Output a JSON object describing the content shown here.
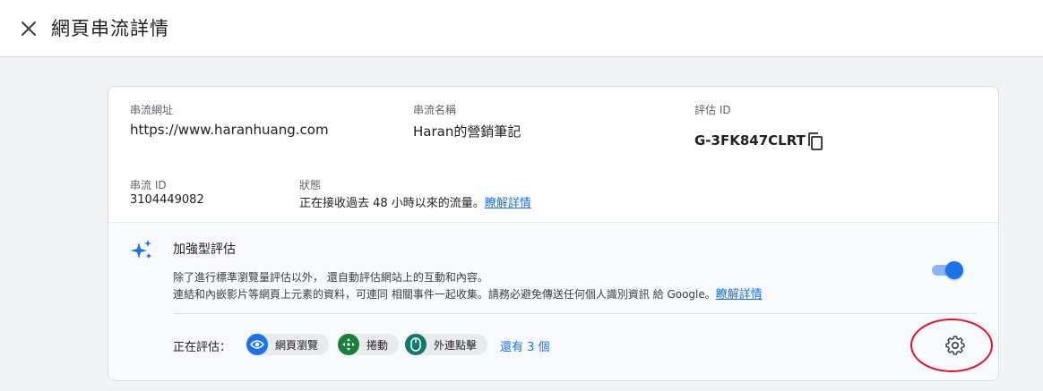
{
  "header": {
    "title": "網頁串流詳情",
    "close_icon": "close-icon"
  },
  "stream": {
    "url_label": "串流網址",
    "url_value": "https://www.haranhuang.com",
    "name_label": "串流名稱",
    "name_value": "Haran的營銷筆記",
    "measurement_label": "評估 ID",
    "measurement_value": "G-3FK847CLRT",
    "id_label": "串流 ID",
    "id_value": "3104449082",
    "status_label": "狀態",
    "status_text": "正在接收過去 48 小時以來的流量。",
    "status_link": "瞭解詳情"
  },
  "enhanced": {
    "title": "加強型評估",
    "line1": "除了進行標準瀏覽量評估以外， 還自動評估網站上的互動和內容。",
    "line2": "連結和內嵌影片等網頁上元素的資料，可連同 相關事件一起收集。請務必避免傳送任何個人識別資訊 給 Google。",
    "learn_more": "瞭解詳情",
    "toggle_on": true,
    "measuring_label": "正在評估：",
    "chips": [
      {
        "label": "網頁瀏覽",
        "icon": "eye-icon",
        "color": "#1a73e8"
      },
      {
        "label": "捲動",
        "icon": "move-icon",
        "color": "#188038"
      },
      {
        "label": "外連點擊",
        "icon": "mouse-icon",
        "color": "#12786b"
      }
    ],
    "more_link": "還有 3 個"
  },
  "colors": {
    "accent": "#1a73e8",
    "annotation": "#e0142d"
  }
}
